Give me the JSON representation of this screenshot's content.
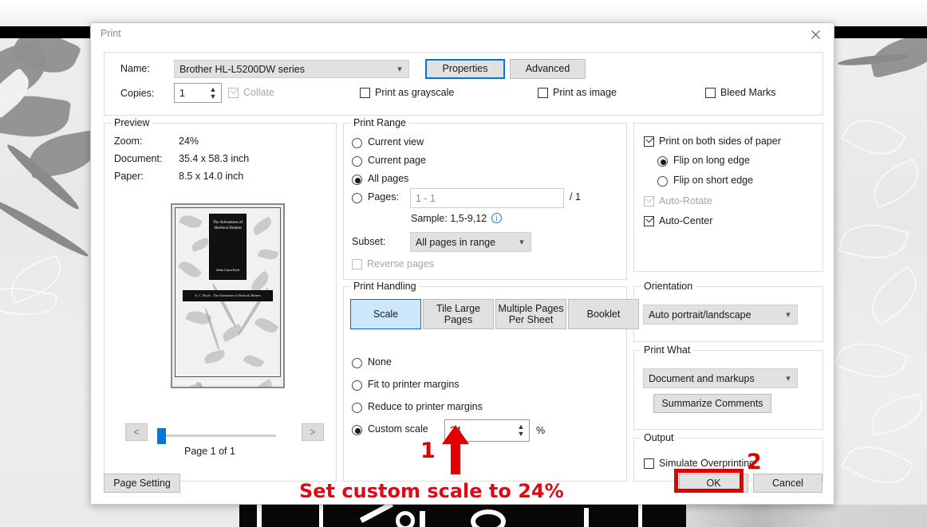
{
  "window": {
    "title": "Print",
    "close_icon": "close-icon"
  },
  "printer": {
    "name_label": "Name:",
    "name_value": "Brother HL-L5200DW series",
    "properties_button": "Properties",
    "advanced_button": "Advanced",
    "copies_label": "Copies:",
    "copies_value": "1",
    "collate_label": "Collate",
    "print_as_grayscale_label": "Print as grayscale",
    "print_as_image_label": "Print as image",
    "bleed_marks_label": "Bleed Marks"
  },
  "preview": {
    "legend": "Preview",
    "zoom_label": "Zoom:",
    "zoom_value": "24%",
    "document_label": "Document:",
    "document_value": "35.4 x 58.3 inch",
    "paper_label": "Paper:",
    "paper_value": "8.5 x 14.0 inch",
    "prev_button": "<",
    "next_button": ">",
    "page_status": "Page 1 of 1",
    "thumbnail": {
      "spine_title": "The Adventures of Sherlock Holmes",
      "spine_author": "Arthur Conan Doyle",
      "band_text": "A. C. Doyle – The Adventures of Sherlock Holmes"
    }
  },
  "print_range": {
    "legend": "Print Range",
    "options": [
      {
        "label": "Current view",
        "selected": false
      },
      {
        "label": "Current page",
        "selected": false
      },
      {
        "label": "All pages",
        "selected": true
      },
      {
        "label": "Pages:",
        "selected": false
      }
    ],
    "pages_placeholder": "1 - 1",
    "pages_total": "/ 1",
    "sample_text": "Sample: 1,5-9,12",
    "info_icon": "info-icon",
    "subset_label": "Subset:",
    "subset_value": "All pages in range",
    "reverse_pages_label": "Reverse pages"
  },
  "duplex": {
    "both_sides_label": "Print on both sides of paper",
    "flip_long_label": "Flip on long edge",
    "flip_short_label": "Flip on short edge",
    "auto_rotate_label": "Auto-Rotate",
    "auto_center_label": "Auto-Center"
  },
  "print_handling": {
    "legend": "Print Handling",
    "tabs": [
      {
        "label": "Scale",
        "selected": true
      },
      {
        "label": "Tile Large Pages",
        "selected": false
      },
      {
        "label": "Multiple Pages Per Sheet",
        "selected": false
      },
      {
        "label": "Booklet",
        "selected": false
      }
    ],
    "options": [
      {
        "label": "None",
        "selected": false
      },
      {
        "label": "Fit to printer margins",
        "selected": false
      },
      {
        "label": "Reduce to printer margins",
        "selected": false
      },
      {
        "label": "Custom scale",
        "selected": true
      }
    ],
    "custom_scale_value": "24",
    "percent_symbol": "%"
  },
  "orientation": {
    "legend": "Orientation",
    "value": "Auto portrait/landscape"
  },
  "print_what": {
    "legend": "Print What",
    "value": "Document and markups",
    "summarize_button": "Summarize Comments"
  },
  "output": {
    "legend": "Output",
    "simulate_overprinting_label": "Simulate Overprinting"
  },
  "footer": {
    "page_setting_button": "Page Setting",
    "ok_button": "OK",
    "cancel_button": "Cancel"
  },
  "annotations": {
    "step1_number": "1",
    "step2_number": "2",
    "instruction": "Set custom scale to 24%",
    "accent_color": "#e30613"
  }
}
